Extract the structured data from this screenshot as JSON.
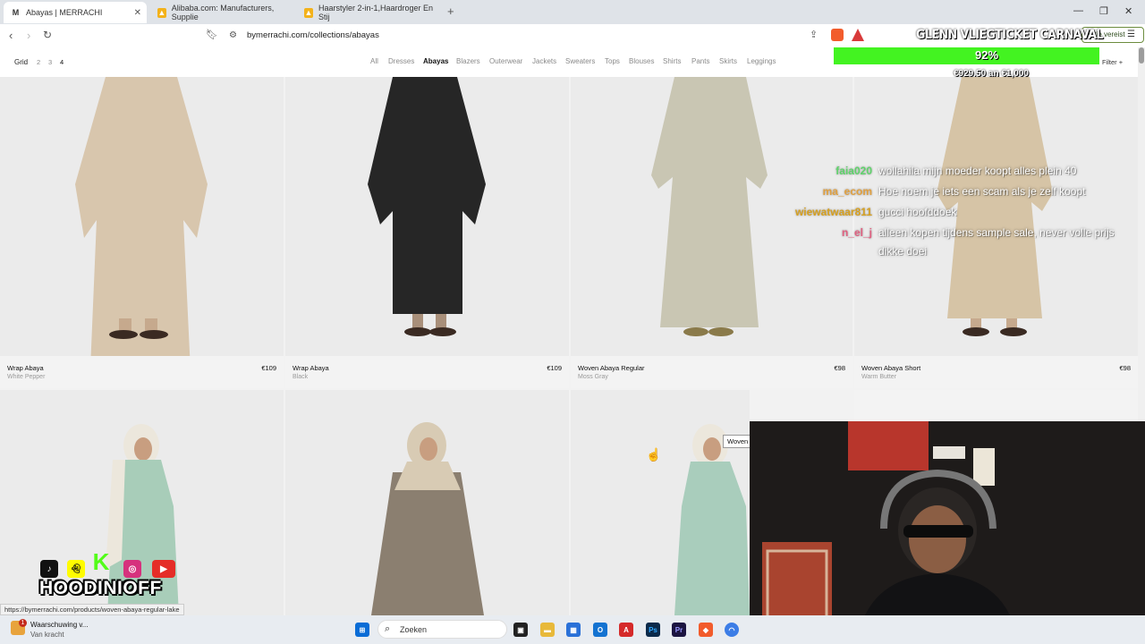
{
  "browser": {
    "tabs": [
      {
        "label": "Abayas | MERRACHI",
        "active": true,
        "favicon": "M"
      },
      {
        "label": "Alibaba.com: Manufacturers, Supplie",
        "active": false,
        "favicon": "alibaba-icon"
      },
      {
        "label": "Haarstyler 2-in-1,Haardroger En Stij",
        "active": false,
        "favicon": "alibaba-icon"
      }
    ],
    "new_tab": "+",
    "url": "bymerrachi.com/collections/abayas",
    "profile_button": "Actie vereist"
  },
  "site": {
    "grid_label": "Grid",
    "grid_options": [
      "2",
      "3",
      "4"
    ],
    "grid_selected": "4",
    "categories": [
      "All",
      "Dresses",
      "Abayas",
      "Blazers",
      "Outerwear",
      "Jackets",
      "Sweaters",
      "Tops",
      "Blouses",
      "Shirts",
      "Pants",
      "Skirts",
      "Leggings"
    ],
    "category_selected": "Abayas",
    "filter_label": "Filter +",
    "products": [
      {
        "name": "Wrap Abaya",
        "price": "€109",
        "color": "White Pepper",
        "swatch": "#d8c6ad"
      },
      {
        "name": "Wrap Abaya",
        "price": "€109",
        "color": "Black",
        "swatch": "#262626"
      },
      {
        "name": "Woven Abaya Regular",
        "price": "€98",
        "color": "Moss Gray",
        "swatch": "#c9c6b3"
      },
      {
        "name": "Woven Abaya Short",
        "price": "€98",
        "color": "Warm Butter",
        "swatch": "#d6c4a6"
      },
      {
        "name": "",
        "price": "",
        "color": "",
        "swatch": "#a8cdb9"
      },
      {
        "name": "",
        "price": "",
        "color": "",
        "swatch": "#8b7f70"
      },
      {
        "name": "",
        "price": "",
        "color": "",
        "swatch": "#a9cdbc"
      }
    ],
    "hover_tooltip": "Woven"
  },
  "overlay": {
    "goal_title": "GLENN VLIEGTICKET CARNAVAL",
    "goal_percent": "92%",
    "goal_progress": 0.92,
    "goal_amount": "€929.50 an €1,000",
    "chat": [
      {
        "user": "faia020",
        "color": "#5fd36b",
        "message": "wollahila mijn moeder koopt alles plein 40"
      },
      {
        "user": "ma_ecom",
        "color": "#e0a040",
        "message": "Hoe noem je iets een scam als je zelf koopt"
      },
      {
        "user": "wiewatwaar811",
        "color": "#d6a020",
        "message": "gucci hoofddoek"
      },
      {
        "user": "n_el_j",
        "color": "#e06080",
        "message": "alleen kopen tijdens sample sale, never volle prijs dikke doei"
      }
    ],
    "brand": "HOODINIOFF",
    "socials": [
      "tiktok-icon",
      "snapchat-icon",
      "kick-icon",
      "instagram-icon",
      "youtube-icon"
    ]
  },
  "status_url": "https://bymerrachi.com/products/woven-abaya-regular-lake",
  "taskbar": {
    "notification_title": "Waarschuwing v...",
    "notification_sub": "Van kracht",
    "notification_badge": "1",
    "search_placeholder": "Zoeken"
  }
}
